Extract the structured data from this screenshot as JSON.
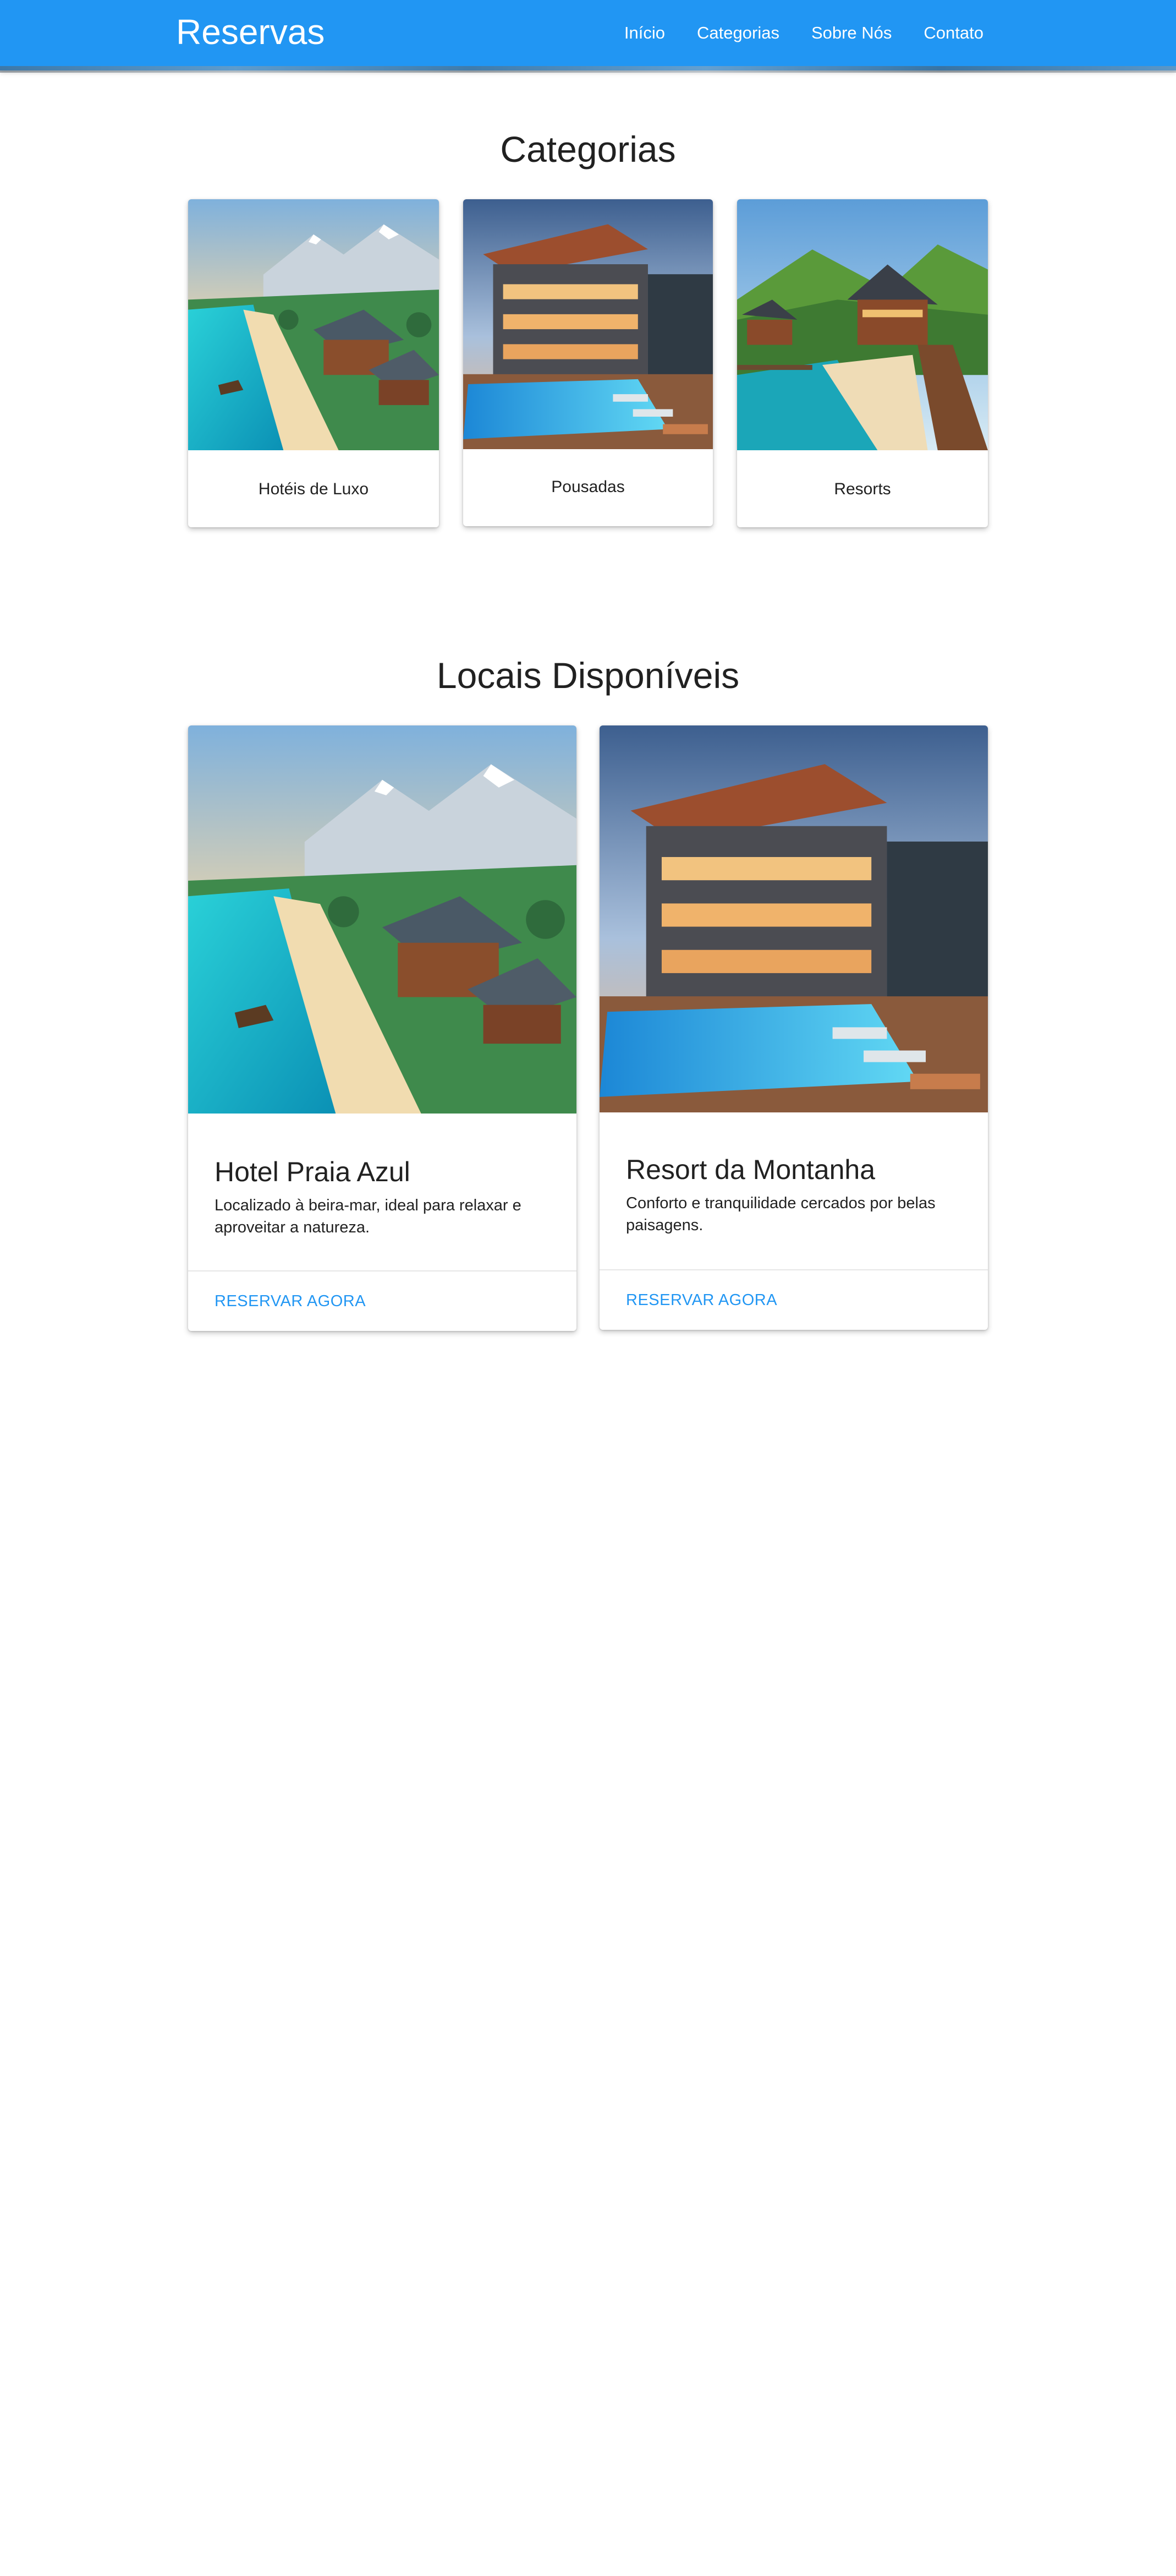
{
  "nav": {
    "brand": "Reservas",
    "items": [
      "Início",
      "Categorias",
      "Sobre Nós",
      "Contato"
    ]
  },
  "categories": {
    "title": "Categorias",
    "cards": [
      {
        "label": "Hotéis de Luxo",
        "image": "beach-resort-mountains-image"
      },
      {
        "label": "Pousadas",
        "image": "modern-hotel-pool-image"
      },
      {
        "label": "Resorts",
        "image": "hillside-lodge-beach-image"
      }
    ]
  },
  "locations": {
    "title": "Locais Disponíveis",
    "cards": [
      {
        "title": "Hotel Praia Azul",
        "description": "Localizado à beira-mar, ideal para relaxar e aproveitar a natureza.",
        "action": "RESERVAR AGORA",
        "image": "beach-resort-mountains-image"
      },
      {
        "title": "Resort da Montanha",
        "description": "Conforto e tranquilidade cercados por belas paisagens.",
        "action": "RESERVAR AGORA",
        "image": "modern-hotel-pool-image"
      }
    ]
  },
  "colors": {
    "primary": "#2196f3",
    "text": "#212121",
    "background": "#ffffff"
  }
}
